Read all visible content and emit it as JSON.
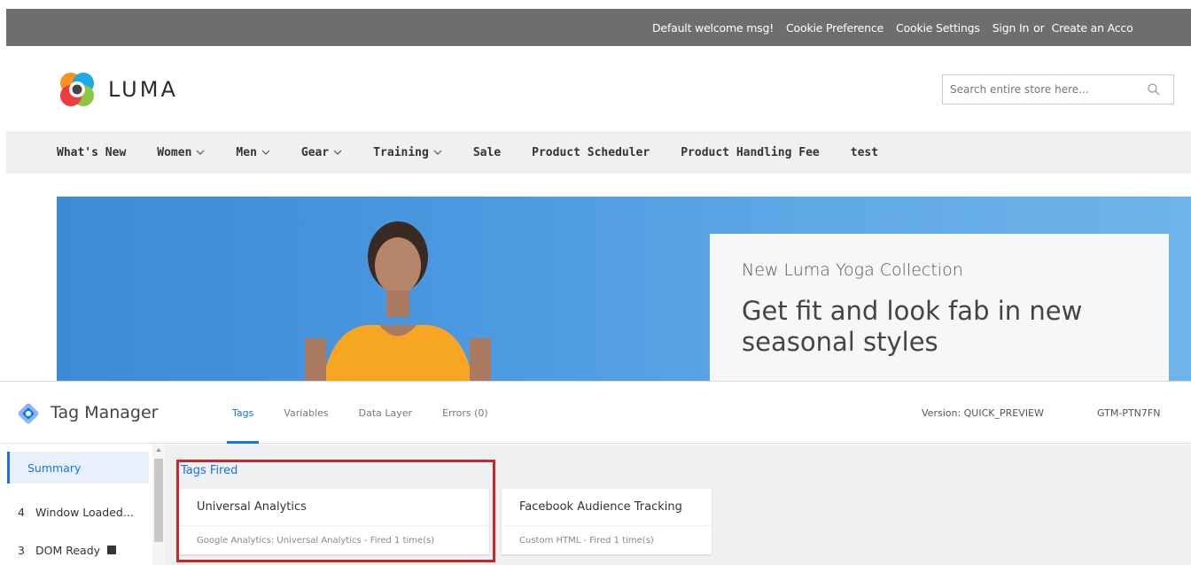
{
  "store": {
    "topbar_links": [
      "Default welcome msg!",
      "Cookie Preference",
      "Cookie Settings",
      "Sign In",
      "or",
      "Create an Acco"
    ],
    "logo_text": "LUMA",
    "search_placeholder": "Search entire store here...",
    "nav": [
      {
        "label": "What's New",
        "dropdown": false
      },
      {
        "label": "Women",
        "dropdown": true
      },
      {
        "label": "Men",
        "dropdown": true
      },
      {
        "label": "Gear",
        "dropdown": true
      },
      {
        "label": "Training",
        "dropdown": true
      },
      {
        "label": "Sale",
        "dropdown": false
      },
      {
        "label": "Product Scheduler",
        "dropdown": false
      },
      {
        "label": "Product Handling Fee",
        "dropdown": false
      },
      {
        "label": "test",
        "dropdown": false
      }
    ],
    "hero": {
      "kicker": "New Luma Yoga Collection",
      "headline": "Get fit and look fab in new seasonal styles"
    }
  },
  "tag_manager": {
    "title": "Tag Manager",
    "tabs": [
      "Tags",
      "Variables",
      "Data Layer",
      "Errors (0)"
    ],
    "active_tab": "Tags",
    "version": "Version: QUICK_PREVIEW",
    "container_id": "GTM-PTN7FN",
    "sidebar": [
      {
        "num": "",
        "label": "Summary",
        "active": true
      },
      {
        "num": "4",
        "label": "Window Loaded...",
        "active": false
      },
      {
        "num": "3",
        "label": "DOM Ready",
        "active": false
      }
    ],
    "fired_label": "Tags Fired",
    "tags": [
      {
        "name": "Universal Analytics",
        "desc": "Google Analytics: Universal Analytics - Fired 1 time(s)"
      },
      {
        "name": "Facebook Audience Tracking",
        "desc": "Custom HTML - Fired 1 time(s)"
      }
    ]
  },
  "colors": {
    "topbar": "#6e6e6e",
    "gtm_blue": "#1a73e8",
    "highlight_red": "#c9262c",
    "hero_blue": "#4a98e0"
  }
}
